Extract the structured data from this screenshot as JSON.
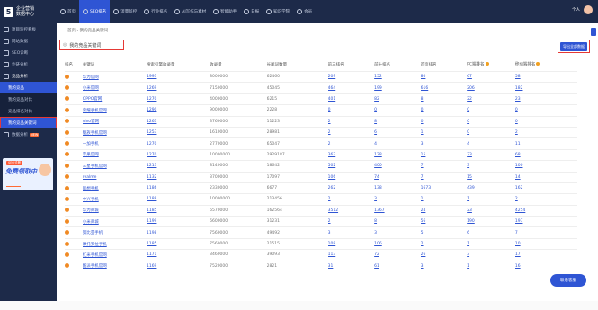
{
  "logo": {
    "mark": "5",
    "line1": "企业营销",
    "line2": "数据中心"
  },
  "sidebar": {
    "items": [
      {
        "label": "项目监控看板",
        "kind": "top"
      },
      {
        "label": "网站数据",
        "kind": "top"
      },
      {
        "label": "SEO诊断",
        "kind": "top"
      },
      {
        "label": "外链分析",
        "kind": "top"
      },
      {
        "label": "竞品分析",
        "kind": "parent-open"
      },
      {
        "label": "我的竞品",
        "kind": "sub-active"
      },
      {
        "label": "我的竞品对比",
        "kind": "sub"
      },
      {
        "label": "竞品排名对比",
        "kind": "sub"
      },
      {
        "label": "我的竞品关键词",
        "kind": "sub-selected"
      },
      {
        "label": "数据分析",
        "kind": "top",
        "tag": "NEW"
      }
    ],
    "banner": {
      "top": "SEO诊断",
      "main": "免费领取中"
    }
  },
  "topbar": {
    "nav": [
      {
        "label": "首页",
        "active": false
      },
      {
        "label": "SEO排名",
        "active": true
      },
      {
        "label": "流量监控",
        "active": false
      },
      {
        "label": "行业排名",
        "active": false
      },
      {
        "label": "AI写作与素材",
        "active": false
      },
      {
        "label": "智能助手",
        "active": false
      },
      {
        "label": "日报",
        "active": false
      },
      {
        "label": "知识学院",
        "active": false
      },
      {
        "label": "会员",
        "active": false
      }
    ],
    "right": "个人"
  },
  "breadcrumb": "首页 › 我的竞品关键词",
  "page_title": "我的竞品关键词",
  "export_label": "导出全部数据",
  "table": {
    "headers": [
      "排名",
      "关键词",
      "搜索引擎收录量",
      "收录量",
      "长尾词数量",
      "前三排名",
      "前十排名",
      "首页排名",
      "PC端排名",
      "移动端排名"
    ],
    "rows": [
      [
        "1",
        "华为官网",
        "1993",
        "8000000",
        "62460",
        "209",
        "152",
        "80",
        "67",
        "58"
      ],
      [
        "2",
        "小米官网",
        "1269",
        "7150000",
        "45045",
        "464",
        "199",
        "616",
        "206",
        "182"
      ],
      [
        "3",
        "OPPO官网",
        "1270",
        "4000000",
        "6215",
        "401",
        "82",
        "8",
        "22",
        "23"
      ],
      [
        "4",
        "荣耀手机官网",
        "1290",
        "9000000",
        "2228",
        "0",
        "0",
        "0",
        "0",
        "0"
      ],
      [
        "5",
        "vivo官网",
        "1263",
        "3760000",
        "11223",
        "2",
        "8",
        "0",
        "0",
        "0"
      ],
      [
        "6",
        "魅族手机官网",
        "1253",
        "1610000",
        "28981",
        "2",
        "6",
        "1",
        "0",
        "2"
      ],
      [
        "7",
        "一加手机",
        "1270",
        "2770000",
        "65047",
        "2",
        "4",
        "3",
        "4",
        "11"
      ],
      [
        "8",
        "苹果官网",
        "1270",
        "10000000",
        "2929187",
        "367",
        "128",
        "15",
        "33",
        "68"
      ],
      [
        "9",
        "三星手机官网",
        "1213",
        "8140000",
        "18642",
        "502",
        "400",
        "7",
        "3",
        "100"
      ],
      [
        "10",
        "realme",
        "1132",
        "3700000",
        "17097",
        "106",
        "74",
        "7",
        "15",
        "14"
      ],
      [
        "11",
        "联想手机",
        "1186",
        "2330000",
        "6677",
        "262",
        "138",
        "1673",
        "439",
        "162"
      ],
      [
        "12",
        "中兴手机",
        "1188",
        "10000000",
        "213456",
        "2",
        "3",
        "1",
        "1",
        "2"
      ],
      [
        "13",
        "华为商城",
        "1185",
        "6570000",
        "162564",
        "3512",
        "1367",
        "24",
        "23",
        "4254"
      ],
      [
        "14",
        "小米商城",
        "1199",
        "6600000",
        "31231",
        "2",
        "8",
        "56",
        "190",
        "197"
      ],
      [
        "15",
        "努比亚手机",
        "1198",
        "7560000",
        "49492",
        "3",
        "3",
        "5",
        "6",
        "7"
      ],
      [
        "16",
        "摩托罗拉手机",
        "1185",
        "7560000",
        "21515",
        "108",
        "106",
        "2",
        "1",
        "10"
      ],
      [
        "17",
        "红米手机官网",
        "1171",
        "3460000",
        "39093",
        "113",
        "72",
        "26",
        "3",
        "17"
      ],
      [
        "18",
        "酷派手机官网",
        "1169",
        "7520000",
        "2821",
        "31",
        "61",
        "3",
        "1",
        "16"
      ]
    ]
  },
  "feedback_label": "联系客服"
}
